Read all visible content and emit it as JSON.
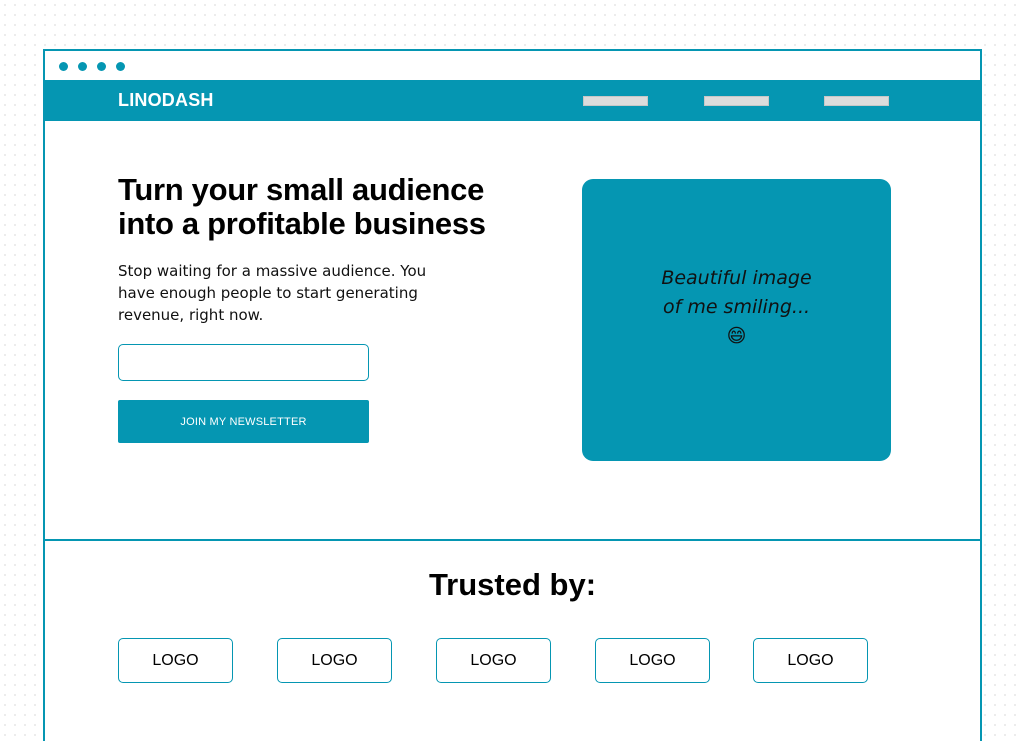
{
  "colors": {
    "accent": "#0596b2",
    "nav_placeholder": "#dcdcdc",
    "text": "#000000",
    "background": "#ffffff"
  },
  "navbar": {
    "brand": "LINODASH",
    "items": [
      "",
      "",
      ""
    ]
  },
  "hero": {
    "title": "Turn your small audience into a profitable business",
    "subtitle": "Stop waiting for a massive audience. You have enough people to start generating revenue, right now.",
    "email_input_value": "",
    "email_input_placeholder": "",
    "cta_label": "JOIN MY NEWSLETTER",
    "image_caption": "Beautiful image of me smiling...😄"
  },
  "trusted": {
    "title": "Trusted by:",
    "logos": [
      "LOGO",
      "LOGO",
      "LOGO",
      "LOGO",
      "LOGO"
    ]
  }
}
